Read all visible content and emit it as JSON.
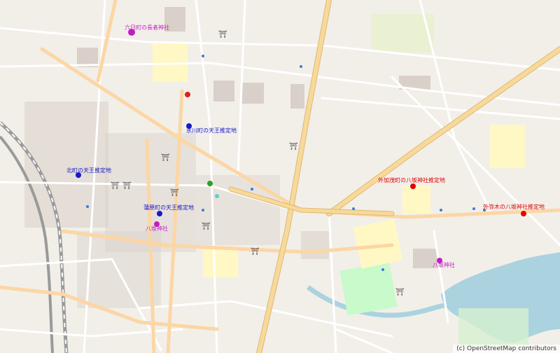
{
  "labels": {
    "shrine_nagasaki": "六日町の長者神社",
    "tenno_hikawa": "氷川町の天王推定地",
    "tenno_kitamachi": "北町の天王推定地",
    "tenno_kanbara": "蒲原町の天王推定地",
    "yasaka_sotokamachi": "外加茂町の八坂神社推定地",
    "yasaka_sotohigiki": "外弥木の八坂神社推定地",
    "yasaka_shrine": "八坂神社",
    "park_label": "",
    "hospital_label": ""
  },
  "colors": {
    "land": "#f2efe9",
    "water": "#aad3df",
    "road_primary": "#f7d99a",
    "road_secondary": "#fcd6a4",
    "road_minor": "#ffffff",
    "rail": "#9a9a9a",
    "building": "#d9d0c9",
    "park": "#c8facc",
    "marker_blue": "#1818c8",
    "marker_red": "#e00000",
    "marker_magenta": "#c020c0"
  },
  "attribution": "(c) OpenStreetMap contributors"
}
